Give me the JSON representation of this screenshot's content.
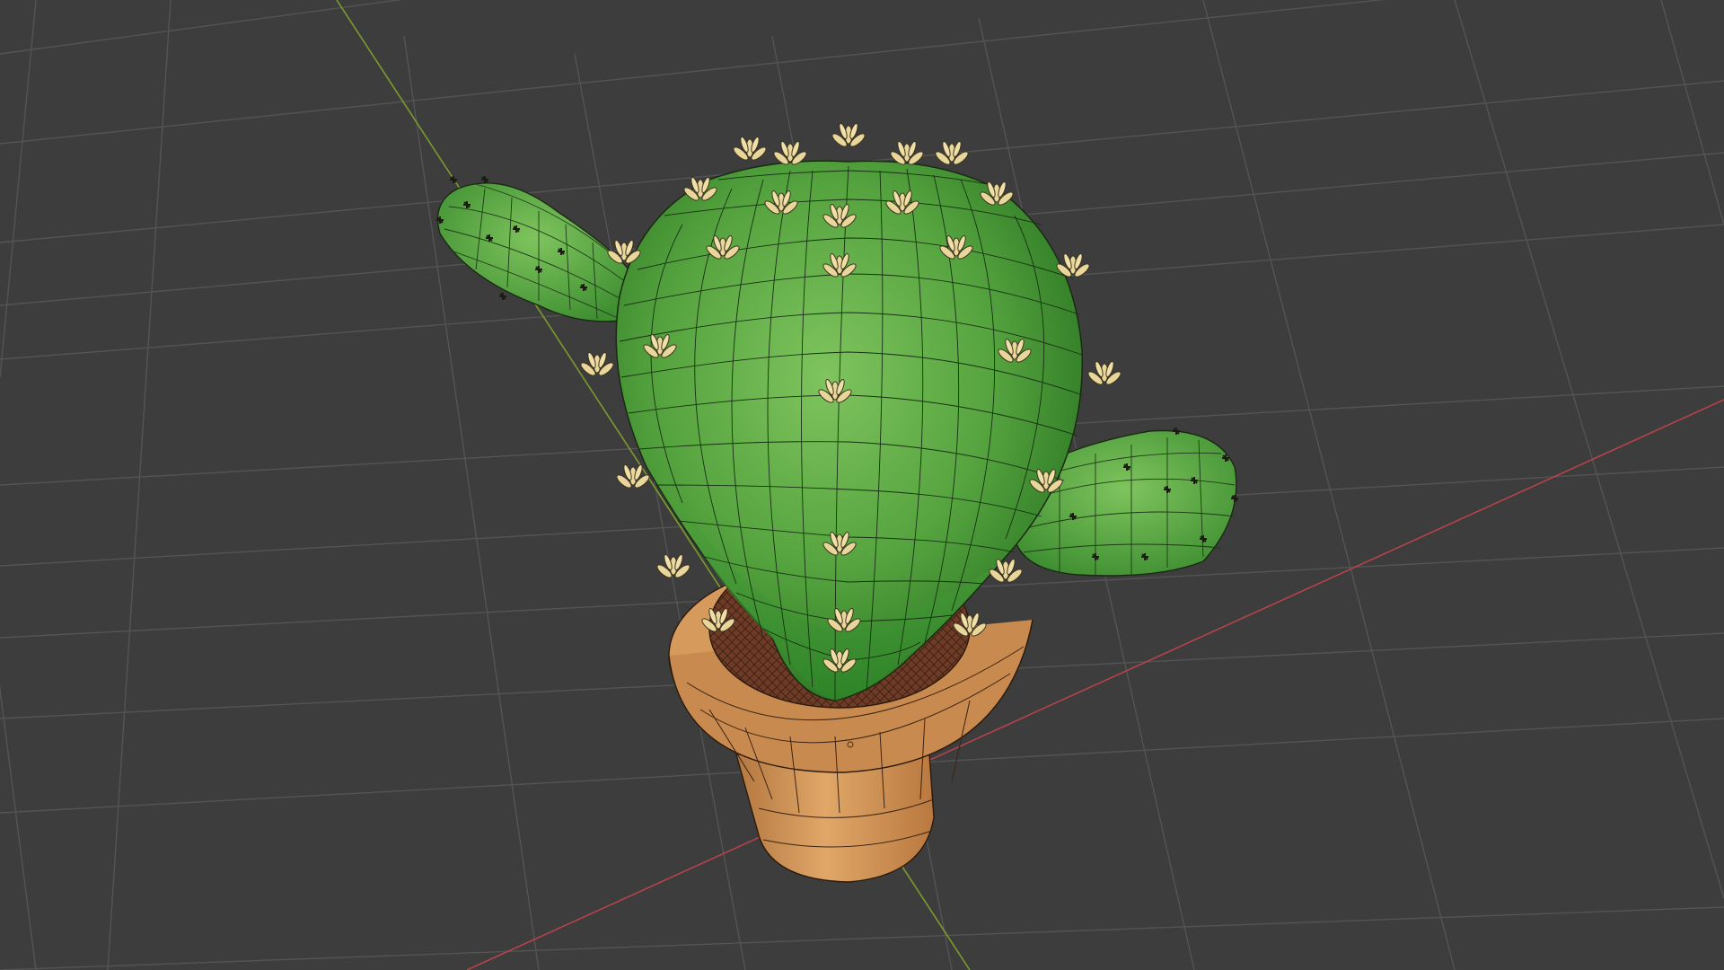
{
  "viewport": {
    "background": "#3d3d3d",
    "grid_color": "#545454",
    "x_axis_color": "#b5434c",
    "y_axis_color": "#7b9b2c"
  },
  "scene": {
    "objects": [
      {
        "name": "cactus-body",
        "color": "#4e9a3c"
      },
      {
        "name": "cactus-left-arm",
        "color": "#5aa845"
      },
      {
        "name": "cactus-right-arm",
        "color": "#5aa845"
      },
      {
        "name": "pot",
        "color": "#c78a52"
      },
      {
        "name": "soil",
        "color": "#6b3a25"
      },
      {
        "name": "spine-clusters",
        "color": "#e6d596"
      }
    ],
    "wireframe_color": "#1a1a1a"
  }
}
